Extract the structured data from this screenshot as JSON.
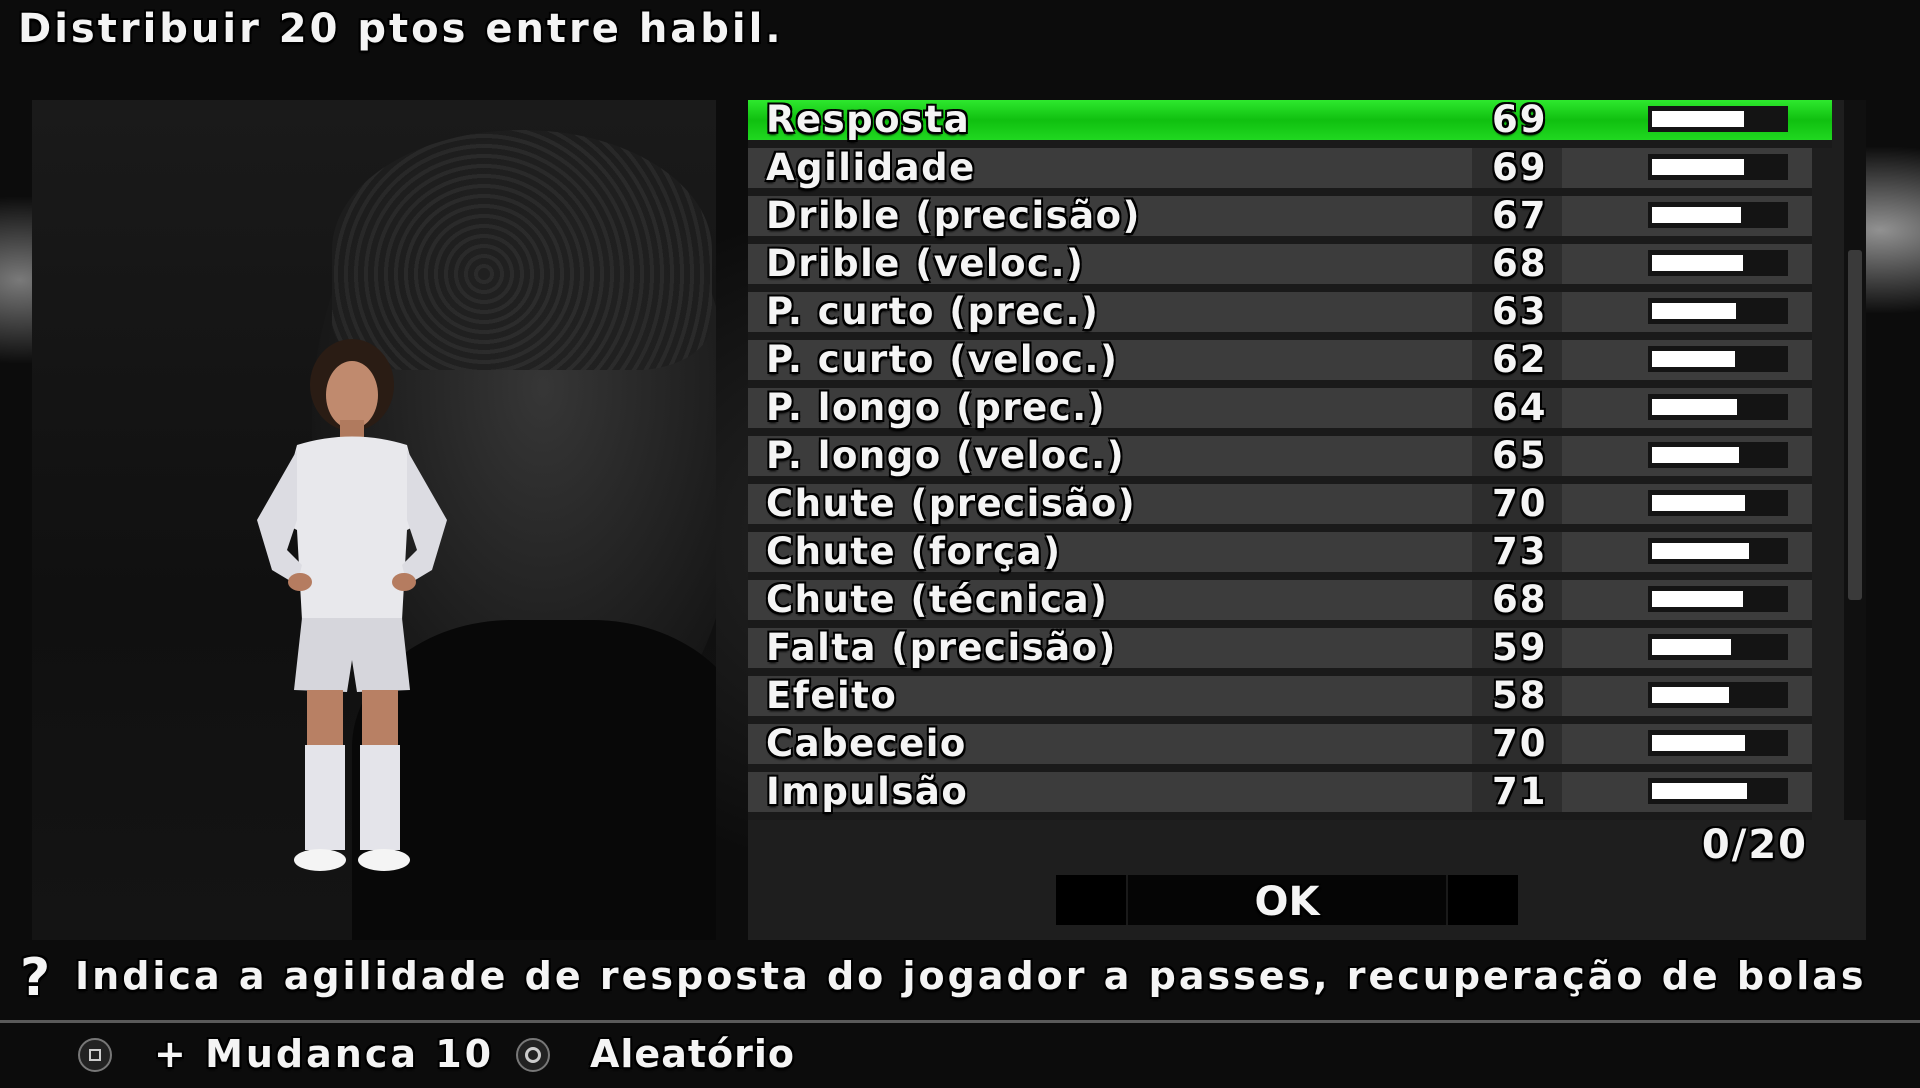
{
  "header": {
    "title": "Distribuir 20 ptos entre habil."
  },
  "stats": {
    "selected_index": 0,
    "max_value": 99,
    "rows": [
      {
        "label": "Resposta",
        "value": "69"
      },
      {
        "label": "Agilidade",
        "value": "69"
      },
      {
        "label": "Drible (precisão)",
        "value": "67"
      },
      {
        "label": "Drible (veloc.)",
        "value": "68"
      },
      {
        "label": "P. curto (prec.)",
        "value": "63"
      },
      {
        "label": "P. curto (veloc.)",
        "value": "62"
      },
      {
        "label": "P. longo (prec.)",
        "value": "64"
      },
      {
        "label": "P. longo (veloc.)",
        "value": "65"
      },
      {
        "label": "Chute (precisão)",
        "value": "70"
      },
      {
        "label": "Chute (força)",
        "value": "73"
      },
      {
        "label": "Chute (técnica)",
        "value": "68"
      },
      {
        "label": "Falta (precisão)",
        "value": "59"
      },
      {
        "label": "Efeito",
        "value": "58"
      },
      {
        "label": "Cabeceio",
        "value": "70"
      },
      {
        "label": "Impulsão",
        "value": "71"
      }
    ]
  },
  "points_counter": "0/20",
  "ok_button": {
    "label": "OK"
  },
  "help": {
    "icon": "question-mark-icon",
    "text": "Indica a agilidade de resposta do jogador a passes, recuperação de bolas e a mo"
  },
  "footer": {
    "change_label": "+ Mudanca 10",
    "random_label": "Aleatório",
    "square_icon": "square-button-icon",
    "circle_icon": "circle-button-icon"
  },
  "colors": {
    "selection_green": "#1fd41f",
    "row_bg": "#3c3c3c",
    "bar_fill": "#ffffff",
    "text": "#f4f4f4"
  }
}
